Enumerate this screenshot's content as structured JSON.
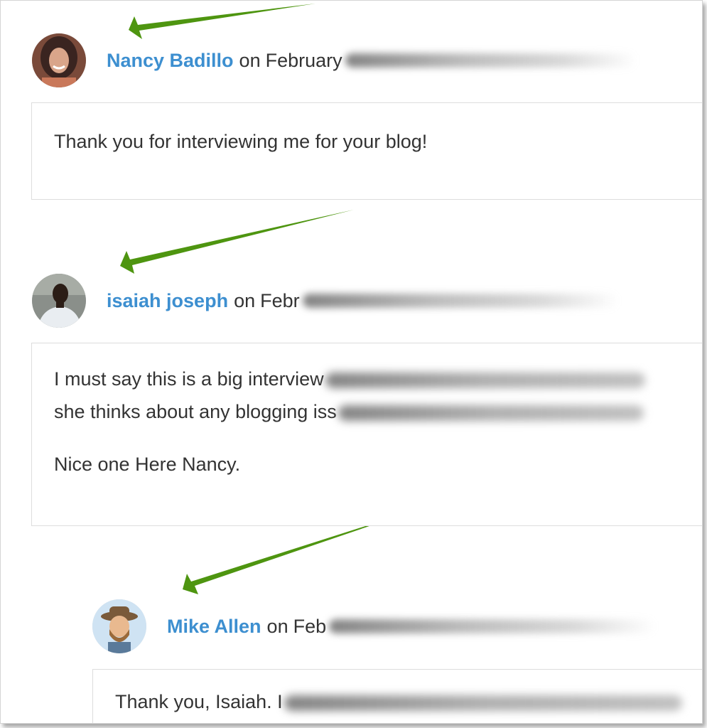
{
  "arrow_color": "#4e9510",
  "author_color": "#3d8fd0",
  "comments": [
    {
      "author": "Nancy Badillo",
      "on": "on",
      "date_visible": "February",
      "paragraphs": [
        "Thank you for interviewing me for your blog!"
      ]
    },
    {
      "author": "isaiah joseph",
      "on": "on",
      "date_visible": "Febr",
      "paragraphs": [
        "I must say this is a big interview",
        "she thinks about any blogging iss",
        "Nice one Here Nancy."
      ]
    },
    {
      "author": "Mike Allen",
      "on": "on",
      "date_visible": "Feb",
      "paragraphs": [
        "Thank you, Isaiah. I"
      ]
    }
  ]
}
